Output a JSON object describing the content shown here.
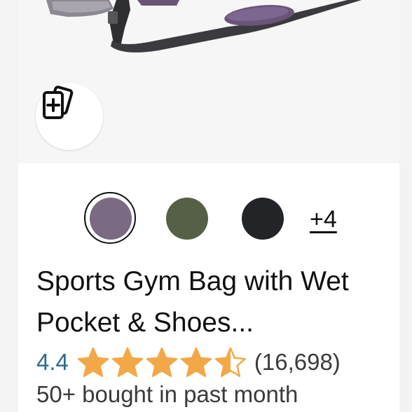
{
  "product": {
    "title": "Sports Gym Bag with Wet Pocket & Shoes...",
    "rating": "4.4",
    "rating_value": 4.4,
    "rating_max": 5,
    "review_count": "(16,698)",
    "bought_text": "50+ bought in past month"
  },
  "swatches": {
    "colors": [
      "#7a6a82",
      "#556047",
      "#222427"
    ],
    "selected_index": 0,
    "more_label": "+4"
  },
  "colors": {
    "star": "#f3a847",
    "rating_link": "#2a6e8c",
    "text": "#0f1111"
  },
  "icons": {
    "compare": "compare-cards-icon"
  }
}
